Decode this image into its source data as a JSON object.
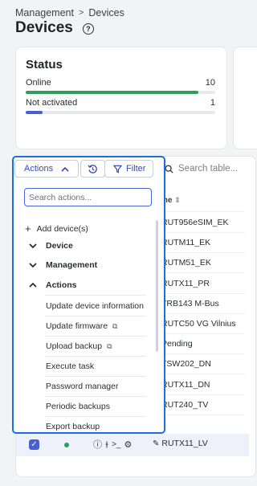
{
  "breadcrumb": {
    "parent": "Management",
    "separator": ">",
    "current": "Devices"
  },
  "page": {
    "title": "Devices"
  },
  "status": {
    "title": "Status",
    "rows": [
      {
        "label": "Online",
        "count": "10",
        "fraction": 0.91,
        "color": "#2e9e5b"
      },
      {
        "label": "Not activated",
        "count": "1",
        "fraction": 0.09,
        "color": "#4a5fd1"
      }
    ]
  },
  "toolbar": {
    "actions_label": "Actions",
    "filter_label": "Filter"
  },
  "table": {
    "search_placeholder": "Search table...",
    "name_header": "me",
    "rows": [
      "RUT956eSIM_EK",
      "RUTM11_EK",
      "RUTM51_EK",
      "RUTX11_PR",
      "TRB143 M-Bus",
      "RUTC50 VG Vilnius",
      "Pending",
      "TSW202_DN",
      "RUTX11_DN",
      "RUT240_TV"
    ],
    "selected_row_name": "RUTX11_LV"
  },
  "actions_menu": {
    "search_placeholder": "Search actions...",
    "add_label": "Add device(s)",
    "sections": [
      {
        "label": "Device",
        "expanded": false
      },
      {
        "label": "Management",
        "expanded": false
      },
      {
        "label": "Actions",
        "expanded": true
      }
    ],
    "items": [
      {
        "label": "Update device information",
        "external": false
      },
      {
        "label": "Update firmware",
        "external": true
      },
      {
        "label": "Upload backup",
        "external": true
      },
      {
        "label": "Execute task",
        "external": false
      },
      {
        "label": "Password manager",
        "external": false
      },
      {
        "label": "Periodic backups",
        "external": false
      },
      {
        "label": "Export backup",
        "external": false
      }
    ]
  },
  "colors": {
    "accent": "#1b6fe0",
    "brand": "#3848b8"
  }
}
